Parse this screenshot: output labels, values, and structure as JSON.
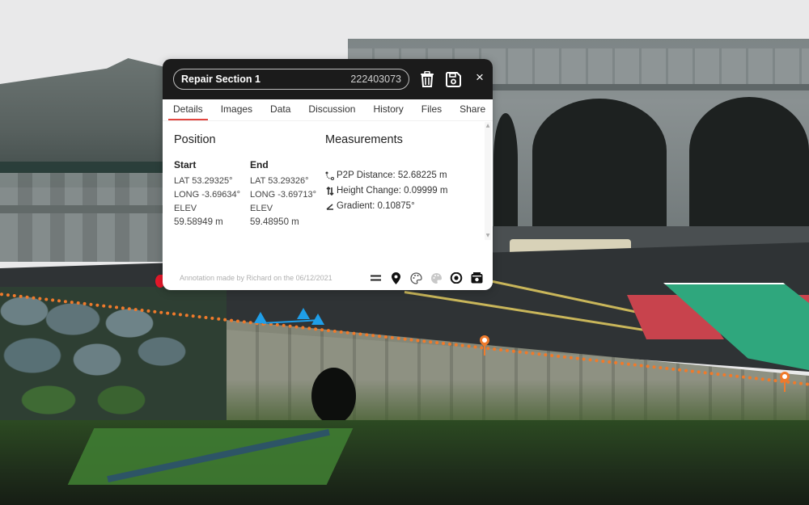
{
  "annotation": {
    "title": "Repair Section 1",
    "id": "222403073",
    "header_actions": {
      "delete": "trash-icon",
      "save": "save-icon",
      "close": "close-icon",
      "close_glyph": "×"
    },
    "tabs": [
      {
        "label": "Details",
        "active": true
      },
      {
        "label": "Images",
        "active": false
      },
      {
        "label": "Data",
        "active": false
      },
      {
        "label": "Discussion",
        "active": false
      },
      {
        "label": "History",
        "active": false
      },
      {
        "label": "Files",
        "active": false
      },
      {
        "label": "Share",
        "active": false
      }
    ],
    "position": {
      "heading": "Position",
      "start": {
        "label": "Start",
        "lat": "LAT 53.29325°",
        "long": "LONG -3.69634°",
        "elev_label": "ELEV",
        "elev": "59.58949 m"
      },
      "end": {
        "label": "End",
        "lat": "LAT 53.29326°",
        "long": "LONG -3.69713°",
        "elev_label": "ELEV",
        "elev": "59.48950 m"
      }
    },
    "measurements": {
      "heading": "Measurements",
      "items": [
        {
          "icon": "p2p-distance-icon",
          "text": "P2P Distance: 52.68225 m"
        },
        {
          "icon": "height-change-icon",
          "text": "Height Change: 0.09999 m"
        },
        {
          "icon": "gradient-icon",
          "text": "Gradient: 0.10875°"
        }
      ]
    },
    "footer": {
      "note": "Annotation made by Richard on the 06/12/2021",
      "tools": [
        "line-style-icon",
        "location-pin-icon",
        "palette-icon",
        "palette-fill-icon",
        "visibility-eye-icon",
        "camera-view-icon"
      ]
    }
  },
  "colors": {
    "accent_tab": "#e2453f",
    "annotation_line": "#ef7a2b",
    "warning_marker": "#1f9ee8",
    "header_bg": "#1b1b1b"
  }
}
